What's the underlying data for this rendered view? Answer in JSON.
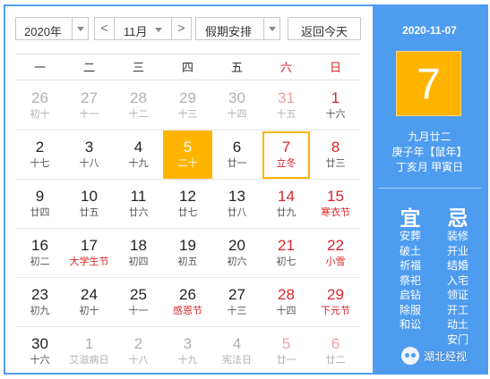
{
  "toolbar": {
    "year": "2020年",
    "prev": "<",
    "month": "11月",
    "next": ">",
    "holiday": "假期安排",
    "today": "返回今天"
  },
  "weekdays": [
    "一",
    "二",
    "三",
    "四",
    "五",
    "六",
    "日"
  ],
  "days": [
    {
      "num": "26",
      "lunar": "初十",
      "state": "other"
    },
    {
      "num": "27",
      "lunar": "十一",
      "state": "other"
    },
    {
      "num": "28",
      "lunar": "十二",
      "state": "other"
    },
    {
      "num": "29",
      "lunar": "十三",
      "state": "other"
    },
    {
      "num": "30",
      "lunar": "十四",
      "state": "other"
    },
    {
      "num": "31",
      "lunar": "十五",
      "state": "other"
    },
    {
      "num": "1",
      "lunar": "十六",
      "state": ""
    },
    {
      "num": "2",
      "lunar": "十七",
      "state": ""
    },
    {
      "num": "3",
      "lunar": "十八",
      "state": ""
    },
    {
      "num": "4",
      "lunar": "十九",
      "state": ""
    },
    {
      "num": "5",
      "lunar": "二十",
      "state": "selected"
    },
    {
      "num": "6",
      "lunar": "廿一",
      "state": ""
    },
    {
      "num": "7",
      "lunar": "立冬",
      "state": "today"
    },
    {
      "num": "8",
      "lunar": "廿三",
      "state": ""
    },
    {
      "num": "9",
      "lunar": "廿四",
      "state": ""
    },
    {
      "num": "10",
      "lunar": "廿五",
      "state": ""
    },
    {
      "num": "11",
      "lunar": "廿六",
      "state": ""
    },
    {
      "num": "12",
      "lunar": "廿七",
      "state": ""
    },
    {
      "num": "13",
      "lunar": "廿八",
      "state": ""
    },
    {
      "num": "14",
      "lunar": "廿九",
      "state": ""
    },
    {
      "num": "15",
      "lunar": "寒衣节",
      "state": "festival"
    },
    {
      "num": "16",
      "lunar": "初二",
      "state": ""
    },
    {
      "num": "17",
      "lunar": "大学生节",
      "state": "festival"
    },
    {
      "num": "18",
      "lunar": "初四",
      "state": ""
    },
    {
      "num": "19",
      "lunar": "初五",
      "state": ""
    },
    {
      "num": "20",
      "lunar": "初六",
      "state": ""
    },
    {
      "num": "21",
      "lunar": "初七",
      "state": ""
    },
    {
      "num": "22",
      "lunar": "小雪",
      "state": "festival"
    },
    {
      "num": "23",
      "lunar": "初九",
      "state": ""
    },
    {
      "num": "24",
      "lunar": "初十",
      "state": ""
    },
    {
      "num": "25",
      "lunar": "十一",
      "state": ""
    },
    {
      "num": "26",
      "lunar": "感恩节",
      "state": "festival"
    },
    {
      "num": "27",
      "lunar": "十三",
      "state": ""
    },
    {
      "num": "28",
      "lunar": "十四",
      "state": ""
    },
    {
      "num": "29",
      "lunar": "下元节",
      "state": "festival"
    },
    {
      "num": "30",
      "lunar": "十六",
      "state": ""
    },
    {
      "num": "1",
      "lunar": "艾滋病日",
      "state": "other"
    },
    {
      "num": "2",
      "lunar": "十八",
      "state": "other"
    },
    {
      "num": "3",
      "lunar": "十九",
      "state": "other"
    },
    {
      "num": "4",
      "lunar": "宪法日",
      "state": "other"
    },
    {
      "num": "5",
      "lunar": "廿一",
      "state": "other"
    },
    {
      "num": "6",
      "lunar": "廿二",
      "state": "other"
    }
  ],
  "side": {
    "date": "2020-11-07",
    "day": "7",
    "lunar_date": "九月廿二",
    "year_ganzhi": "庚子年【鼠年】",
    "month_day_ganzhi": "丁亥月 甲寅日",
    "yi_title": "宜",
    "ji_title": "忌",
    "yi": [
      "安葬",
      "破土",
      "祈福",
      "祭祀",
      "启钻",
      "除服",
      "和讼"
    ],
    "ji": [
      "装修",
      "开业",
      "结婚",
      "入宅",
      "领证",
      "开工",
      "动土",
      "安门"
    ]
  },
  "watermark": "湖北经视",
  "colors": {
    "panel": "#4e9cf0",
    "highlight": "#ffb400",
    "weekend": "#d9242a"
  }
}
